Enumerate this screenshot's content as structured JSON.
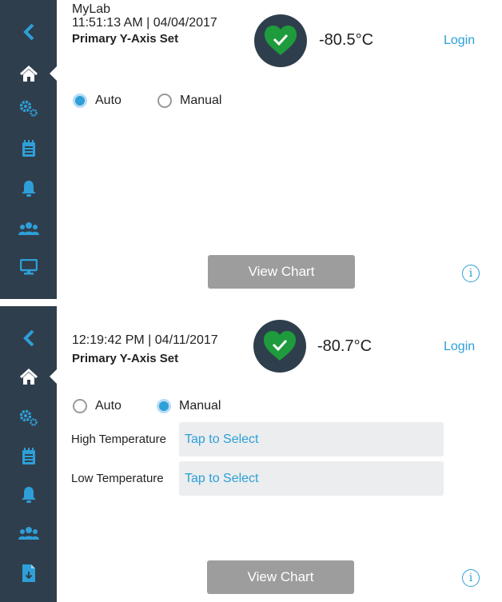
{
  "colors": {
    "sidebar": "#2f3e4c",
    "accent": "#2e9fd8",
    "heart": "#1e9b3c",
    "button": "#9d9d9d",
    "field": "#ebedee"
  },
  "panel1": {
    "lab_name": "MyLab",
    "timestamp": "11:51:13 AM | 04/04/2017",
    "axis_set": "Primary Y-Axis Set",
    "temperature": "-80.5°C",
    "login": "Login",
    "radio_auto": "Auto",
    "radio_manual": "Manual",
    "selected_mode": "Auto",
    "view_chart": "View Chart",
    "info": "i",
    "nav": [
      "back-icon",
      "home-icon",
      "settings-gears-icon",
      "notes-icon",
      "alarm-bell-icon",
      "users-icon",
      "monitor-icon"
    ]
  },
  "panel2": {
    "timestamp": "12:19:42 PM | 04/11/2017",
    "axis_set": "Primary Y-Axis Set",
    "temperature": "-80.7°C",
    "login": "Login",
    "radio_auto": "Auto",
    "radio_manual": "Manual",
    "selected_mode": "Manual",
    "high_label": "High Temperature",
    "high_value": "Tap to Select",
    "low_label": "Low Temperature",
    "low_value": "Tap to Select",
    "view_chart": "View Chart",
    "info": "i",
    "nav": [
      "back-icon",
      "home-icon",
      "settings-gears-icon",
      "notes-icon",
      "alarm-bell-icon",
      "users-icon",
      "export-file-icon"
    ]
  }
}
